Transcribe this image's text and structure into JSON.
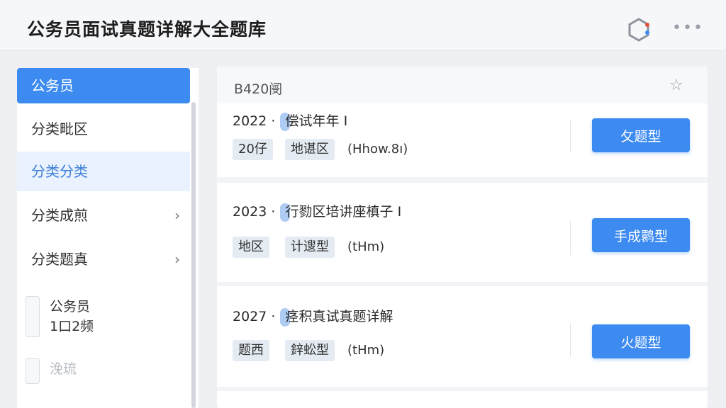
{
  "header": {
    "title": "公务员面试真题详解大全题库",
    "more_label": "•••"
  },
  "sidebar": {
    "items": [
      {
        "label": "公务员"
      },
      {
        "label": "分类毗区"
      },
      {
        "label": "分类分类"
      },
      {
        "label": "分类成煎",
        "chevron": "›"
      },
      {
        "label": "分类题真",
        "chevron": "›"
      }
    ],
    "sub_items": [
      {
        "line1": "公务员",
        "line2": "1口2频"
      },
      {
        "line1": "浼琉",
        "line2": ""
      }
    ]
  },
  "panel": {
    "code": "B420阌",
    "star": "☆",
    "cards": [
      {
        "year": "2022",
        "sep": "·",
        "title": "偿试年年 I",
        "tags": [
          "20仔",
          "地谌区"
        ],
        "extra": "(Hhow.8ı)",
        "button": "攵题型"
      },
      {
        "year": "2023",
        "sep": "·",
        "title": "行勠区培讲座槙子 I",
        "tags": [
          "地区",
          "计遚型"
        ],
        "extra": "(tHm)",
        "button": "手成鹮型"
      },
      {
        "year": "2027",
        "sep": "·",
        "title": "痉积真试真题详解",
        "tags": [
          "题西",
          "鋅蚣型"
        ],
        "extra": "(tHm)",
        "button": "火题型"
      }
    ]
  },
  "colors": {
    "accent": "#3d8bf0",
    "accent_soft": "#e9f2fe",
    "tag_bg": "#e4ebf3",
    "background": "#eef0f4"
  }
}
